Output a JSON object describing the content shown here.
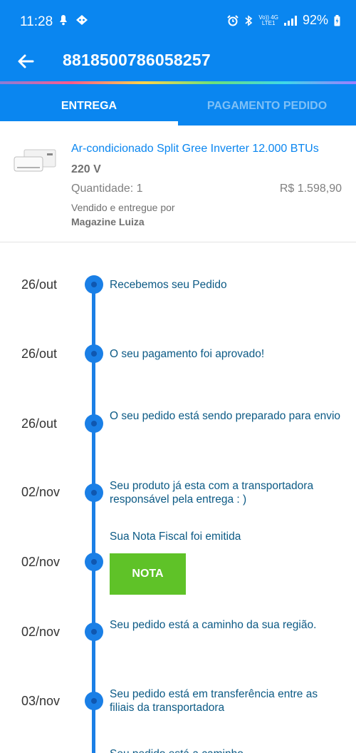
{
  "status_bar": {
    "time": "11:28",
    "left_icons": [
      "silent-icon",
      "game-controller-icon"
    ],
    "net_top": "Vo)) 4G",
    "net_bottom": "LTE1",
    "battery": "92%"
  },
  "app_bar": {
    "title": "8818500786058257"
  },
  "tabs": [
    {
      "label": "ENTREGA",
      "active": true
    },
    {
      "label": "PAGAMENTO PEDIDO",
      "active": false
    }
  ],
  "product": {
    "name": "Ar-condicionado Split Gree Inverter 12.000 BTUs",
    "variant": "220 V",
    "quantity": "Quantidade: 1",
    "price": "R$ 1.598,90",
    "seller_label": "Vendido e entregue por",
    "seller": "Magazine Luiza"
  },
  "timeline": [
    {
      "date": "26/out",
      "text": "Recebemos seu Pedido"
    },
    {
      "date": "26/out",
      "text": "O seu pagamento foi aprovado!"
    },
    {
      "date": "26/out",
      "text": "O seu pedido está sendo preparado para envio"
    },
    {
      "date": "02/nov",
      "text": "Seu produto já esta com a transportadora responsável pela entrega : )"
    },
    {
      "date": "02/nov",
      "text": "Sua Nota Fiscal foi emitida",
      "button": "NOTA"
    },
    {
      "date": "02/nov",
      "text": "Seu pedido está a caminho da sua região."
    },
    {
      "date": "03/nov",
      "text": "Seu pedido está em transferência entre as filiais da transportadora"
    },
    {
      "date": "",
      "text": "Seu pedido está a caminho ..."
    }
  ],
  "colors": {
    "primary": "#0a86f0",
    "timeline": "#1a7fe6",
    "timeline_text": "#0c5a85",
    "nota_button": "#5fc228"
  }
}
